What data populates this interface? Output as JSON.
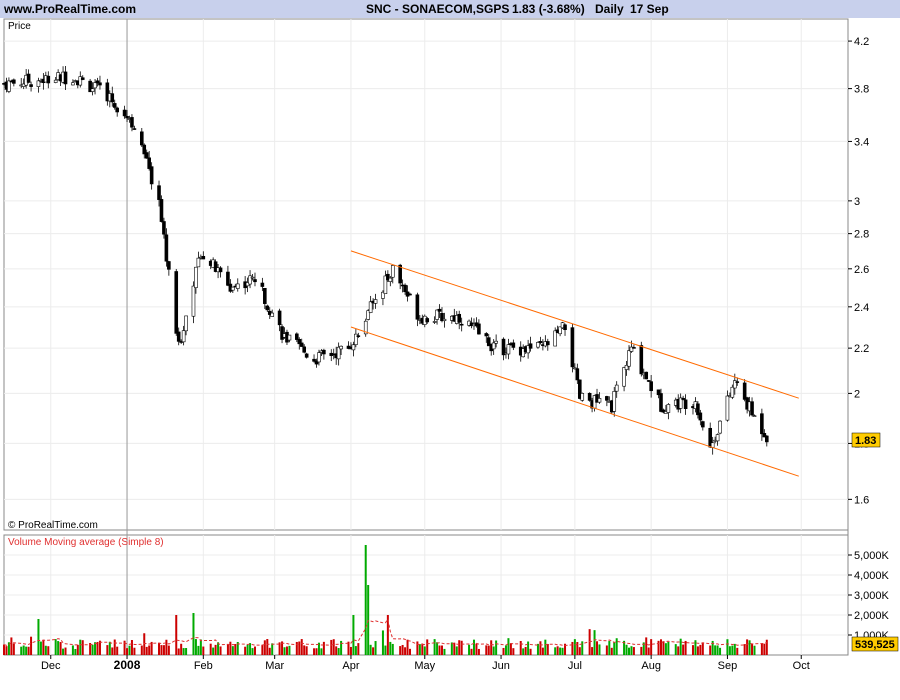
{
  "header": {
    "site": "www.ProRealTime.com",
    "instrument": "SNC - SONAECOM,SGPS",
    "quote": "1.83 (-3.68%)",
    "period": "Daily",
    "date": "17 Sep"
  },
  "colors": {
    "header_bg": "#c8d0ec",
    "up": "#00aa00",
    "down": "#cc0000",
    "channel": "#ff6a00",
    "volume_ma": "#e03030",
    "last_badge": "#ffcc00"
  },
  "chart_data": [
    {
      "type": "candlestick",
      "panel_label": "Price",
      "watermark": "© ProRealTime.com",
      "y_scale": "log",
      "ylim": [
        1.5,
        4.4
      ],
      "y_ticks": [
        "4.2",
        "3.8",
        "3.4",
        "3",
        "2.8",
        "2.6",
        "2.4",
        "2.2",
        "2",
        "1.8",
        "1.6"
      ],
      "last_value": "1.83",
      "x_ticks": [
        {
          "label": "Dec",
          "date": "2007-12-01"
        },
        {
          "label": "2008",
          "date": "2008-01-01",
          "bold": true
        },
        {
          "label": "Feb",
          "date": "2008-02-01"
        },
        {
          "label": "Mar",
          "date": "2008-03-01"
        },
        {
          "label": "Apr",
          "date": "2008-04-01"
        },
        {
          "label": "May",
          "date": "2008-05-01"
        },
        {
          "label": "Jun",
          "date": "2008-06-01"
        },
        {
          "label": "Jul",
          "date": "2008-07-01"
        },
        {
          "label": "Aug",
          "date": "2008-08-01"
        },
        {
          "label": "Sep",
          "date": "2008-09-01"
        },
        {
          "label": "Oct",
          "date": "2008-10-01"
        }
      ],
      "xlim": [
        "2007-11-12",
        "2008-10-20"
      ],
      "key_closes": [
        {
          "date": "2007-11-12",
          "close": 3.84
        },
        {
          "date": "2007-12-10",
          "close": 3.9
        },
        {
          "date": "2007-12-24",
          "close": 3.75
        },
        {
          "date": "2008-01-03",
          "close": 3.55
        },
        {
          "date": "2008-01-14",
          "close": 3.0
        },
        {
          "date": "2008-01-22",
          "close": 2.2
        },
        {
          "date": "2008-01-31",
          "close": 2.7
        },
        {
          "date": "2008-02-12",
          "close": 2.5
        },
        {
          "date": "2008-02-22",
          "close": 2.55
        },
        {
          "date": "2008-03-05",
          "close": 2.25
        },
        {
          "date": "2008-03-17",
          "close": 2.15
        },
        {
          "date": "2008-03-31",
          "close": 2.2
        },
        {
          "date": "2008-04-18",
          "close": 2.6
        },
        {
          "date": "2008-04-29",
          "close": 2.35
        },
        {
          "date": "2008-05-15",
          "close": 2.35
        },
        {
          "date": "2008-05-30",
          "close": 2.2
        },
        {
          "date": "2008-06-18",
          "close": 2.2
        },
        {
          "date": "2008-06-27",
          "close": 2.3
        },
        {
          "date": "2008-07-03",
          "close": 1.98
        },
        {
          "date": "2008-07-16",
          "close": 1.95
        },
        {
          "date": "2008-07-24",
          "close": 2.2
        },
        {
          "date": "2008-08-05",
          "close": 1.95
        },
        {
          "date": "2008-08-19",
          "close": 1.97
        },
        {
          "date": "2008-08-25",
          "close": 1.78
        },
        {
          "date": "2008-09-04",
          "close": 2.05
        },
        {
          "date": "2008-09-12",
          "close": 1.9
        },
        {
          "date": "2008-09-17",
          "close": 1.83
        }
      ],
      "channel": {
        "upper": [
          {
            "date": "2008-04-01",
            "value": 2.7
          },
          {
            "date": "2008-09-30",
            "value": 1.98
          }
        ],
        "lower": [
          {
            "date": "2008-04-01",
            "value": 2.3
          },
          {
            "date": "2008-09-30",
            "value": 1.68
          }
        ]
      }
    },
    {
      "type": "bar",
      "panel_label": "Volume Moving average (Simple 8)",
      "ylim": [
        0,
        6000000
      ],
      "y_ticks": [
        "5,000K",
        "4,000K",
        "3,000K",
        "2,000K",
        "1,000K"
      ],
      "last_value": "539,525",
      "peak_volumes": [
        {
          "date": "2007-11-26",
          "volume": 1800000
        },
        {
          "date": "2008-01-21",
          "volume": 2000000
        },
        {
          "date": "2008-01-28",
          "volume": 2100000
        },
        {
          "date": "2008-04-02",
          "volume": 2000000
        },
        {
          "date": "2008-04-07",
          "volume": 5500000
        },
        {
          "date": "2008-04-08",
          "volume": 3500000
        },
        {
          "date": "2008-04-16",
          "volume": 2000000
        }
      ]
    }
  ]
}
